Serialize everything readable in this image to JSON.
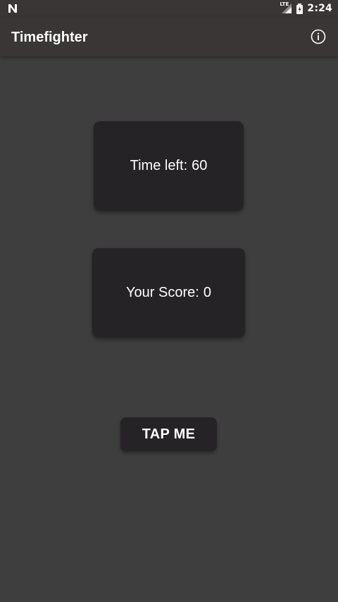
{
  "status_bar": {
    "network_icon": "n-notification-icon",
    "signal_label": "LTE",
    "signal_icon": "cellular-signal-icon",
    "battery_icon": "battery-charging-icon",
    "time": "2:24"
  },
  "app_bar": {
    "title": "Timefighter",
    "info_icon": "info-icon"
  },
  "game": {
    "time_label": "Time left:",
    "time_value": "60",
    "score_label": "Your Score:",
    "score_value": "0",
    "tap_button_label": "TAP ME"
  },
  "colors": {
    "background": "#3e3e3e",
    "bars": "#3a3636",
    "cards": "#252325",
    "text": "#ffffff"
  }
}
